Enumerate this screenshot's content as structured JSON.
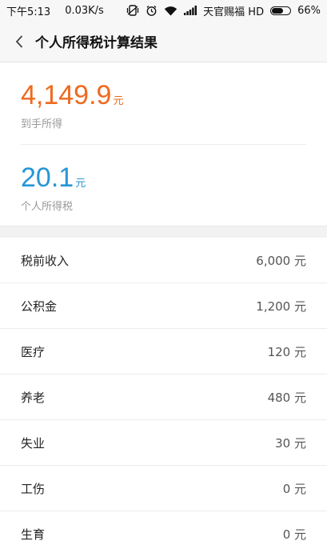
{
  "status_bar": {
    "time": "下午5:13",
    "speed": "0.03K/s",
    "carrier": "天官赐福 HD",
    "battery": "66%",
    "battery_level": 0.66
  },
  "header": {
    "title": "个人所得税计算结果",
    "back_icon": "chevron-left-icon"
  },
  "summary": {
    "take_home": {
      "value": "4,149.9",
      "unit": "元",
      "label": "到手所得",
      "color": "#ee6a1e"
    },
    "tax": {
      "value": "20.1",
      "unit": "元",
      "label": "个人所得税",
      "color": "#2795d6"
    }
  },
  "details": [
    {
      "label": "税前收入",
      "value": "6,000 元"
    },
    {
      "label": "公积金",
      "value": "1,200 元"
    },
    {
      "label": "医疗",
      "value": "120 元"
    },
    {
      "label": "养老",
      "value": "480 元"
    },
    {
      "label": "失业",
      "value": "30 元"
    },
    {
      "label": "工伤",
      "value": "0 元"
    },
    {
      "label": "生育",
      "value": "0 元"
    }
  ]
}
